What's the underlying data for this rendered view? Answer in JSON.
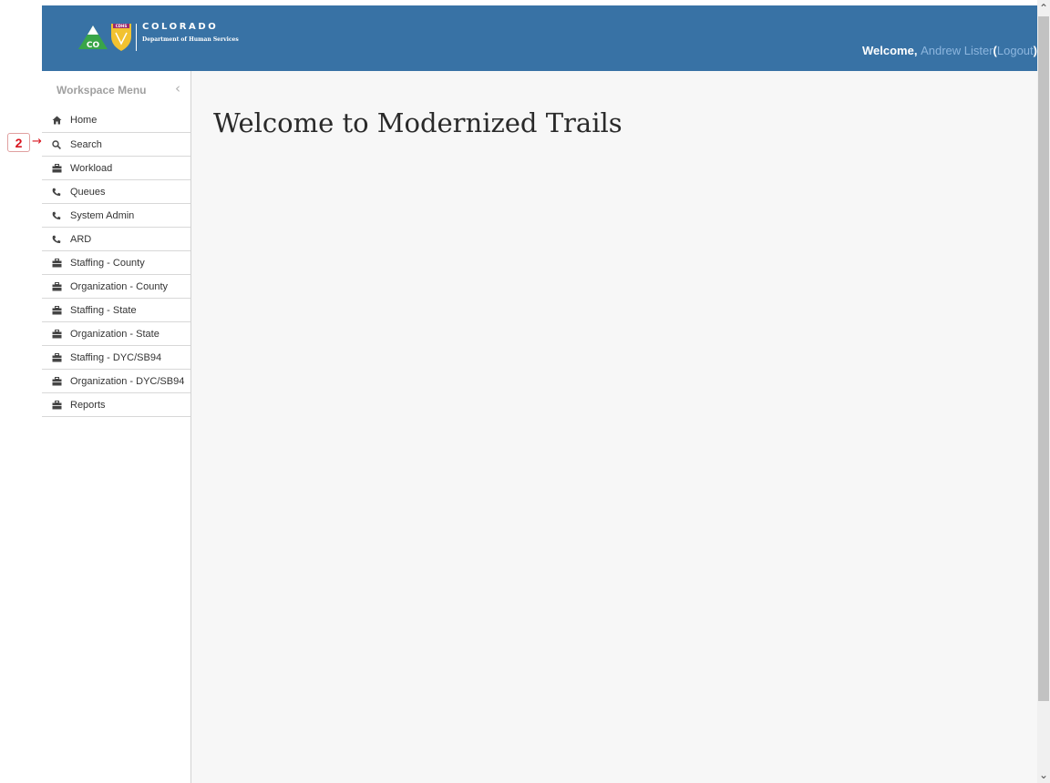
{
  "annotation": {
    "number": "2",
    "arrow": "→"
  },
  "header": {
    "logo_mark": "CO",
    "logo_badge": "CDHS",
    "logo_state": "COLORADO",
    "logo_dept": "Department of Human Services",
    "welcome_prefix": "Welcome,",
    "user_name": "Andrew Lister",
    "paren_open": "(",
    "logout": "Logout",
    "paren_close": ")",
    "color": "#3872a5"
  },
  "sidebar": {
    "title": "Workspace Menu",
    "collapse_glyph": "‹",
    "items": [
      {
        "label": "Home",
        "icon": "home-icon"
      },
      {
        "label": "Search",
        "icon": "search-icon"
      },
      {
        "label": "Workload",
        "icon": "briefcase-icon"
      },
      {
        "label": "Queues",
        "icon": "phone-icon"
      },
      {
        "label": "System Admin",
        "icon": "phone-icon"
      },
      {
        "label": "ARD",
        "icon": "phone-icon"
      },
      {
        "label": "Staffing - County",
        "icon": "briefcase-icon"
      },
      {
        "label": "Organization - County",
        "icon": "briefcase-icon"
      },
      {
        "label": "Staffing - State",
        "icon": "briefcase-icon"
      },
      {
        "label": "Organization - State",
        "icon": "briefcase-icon"
      },
      {
        "label": "Staffing - DYC/SB94",
        "icon": "briefcase-icon"
      },
      {
        "label": "Organization - DYC/SB94",
        "icon": "briefcase-icon"
      },
      {
        "label": "Reports",
        "icon": "briefcase-icon"
      }
    ]
  },
  "main": {
    "title": "Welcome to Modernized Trails"
  },
  "scrollbar": {
    "up": "⌃",
    "down": "⌄"
  }
}
